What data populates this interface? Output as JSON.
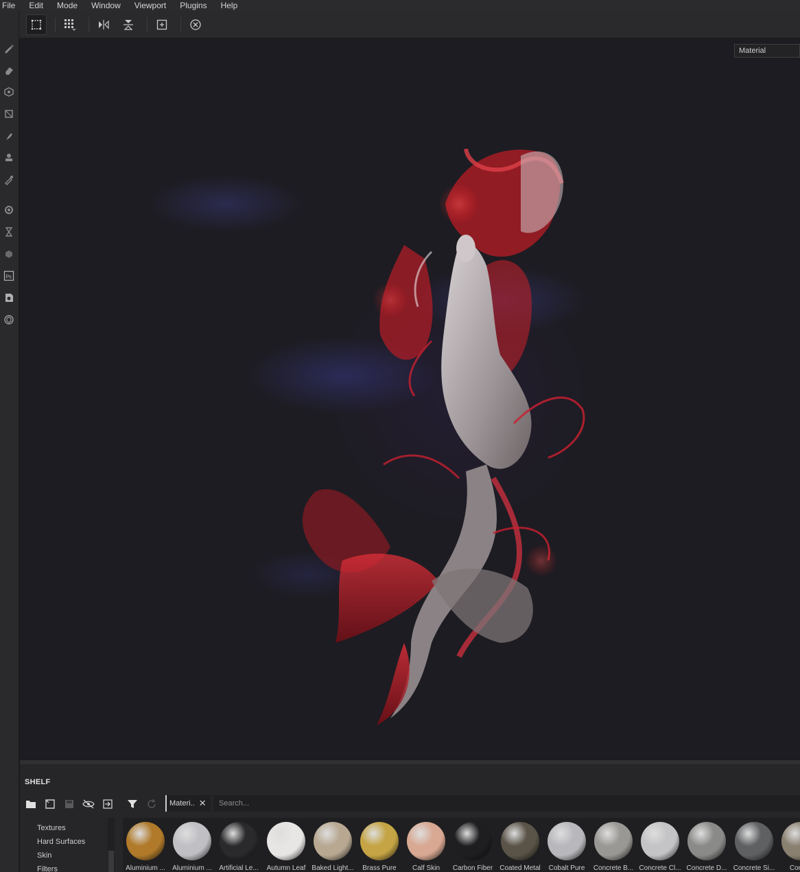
{
  "menu": [
    "File",
    "Edit",
    "Mode",
    "Window",
    "Viewport",
    "Plugins",
    "Help"
  ],
  "toolbar": {
    "buttons": [
      "box-select-icon",
      "grid-icon",
      "mirror-x-icon",
      "mirror-y-icon",
      "frame-icon",
      "reset-icon"
    ]
  },
  "left_tools": [
    "brush-icon",
    "eraser-icon",
    "projection-icon",
    "geometry-icon",
    "smudge-icon",
    "clone-stamp-icon",
    "color-picker-icon",
    "settings-icon",
    "hourglass-icon",
    "cube-icon",
    "photoshop-icon",
    "layer-icon",
    "substance-icon"
  ],
  "viewport": {
    "mode_select": "Material"
  },
  "shelf": {
    "title": "SHELF",
    "filter_chip": "Materi..",
    "search_placeholder": "Search...",
    "categories": [
      "Textures",
      "Hard Surfaces",
      "Skin",
      "Filters"
    ],
    "materials": [
      {
        "label": "Aluminium ...",
        "color": "#b07a2a"
      },
      {
        "label": "Aluminium ...",
        "color": "#c0c0c4"
      },
      {
        "label": "Artificial Le...",
        "color": "#2a2a2c"
      },
      {
        "label": "Autumn Leaf",
        "color": "#e8e6e4"
      },
      {
        "label": "Baked Light...",
        "color": "#b8a892"
      },
      {
        "label": "Brass Pure",
        "color": "#c4a444"
      },
      {
        "label": "Calf Skin",
        "color": "#d8a892"
      },
      {
        "label": "Carbon Fiber",
        "color": "#1e1e20"
      },
      {
        "label": "Coated Metal",
        "color": "#5a5448"
      },
      {
        "label": "Cobalt Pure",
        "color": "#b8b8bc"
      },
      {
        "label": "Concrete B...",
        "color": "#9a9894"
      },
      {
        "label": "Concrete Cl...",
        "color": "#c4c4c6"
      },
      {
        "label": "Concrete D...",
        "color": "#8a8a88"
      },
      {
        "label": "Concrete Si...",
        "color": "#5e6062"
      },
      {
        "label": "Concre",
        "color": "#8a8070"
      }
    ]
  }
}
